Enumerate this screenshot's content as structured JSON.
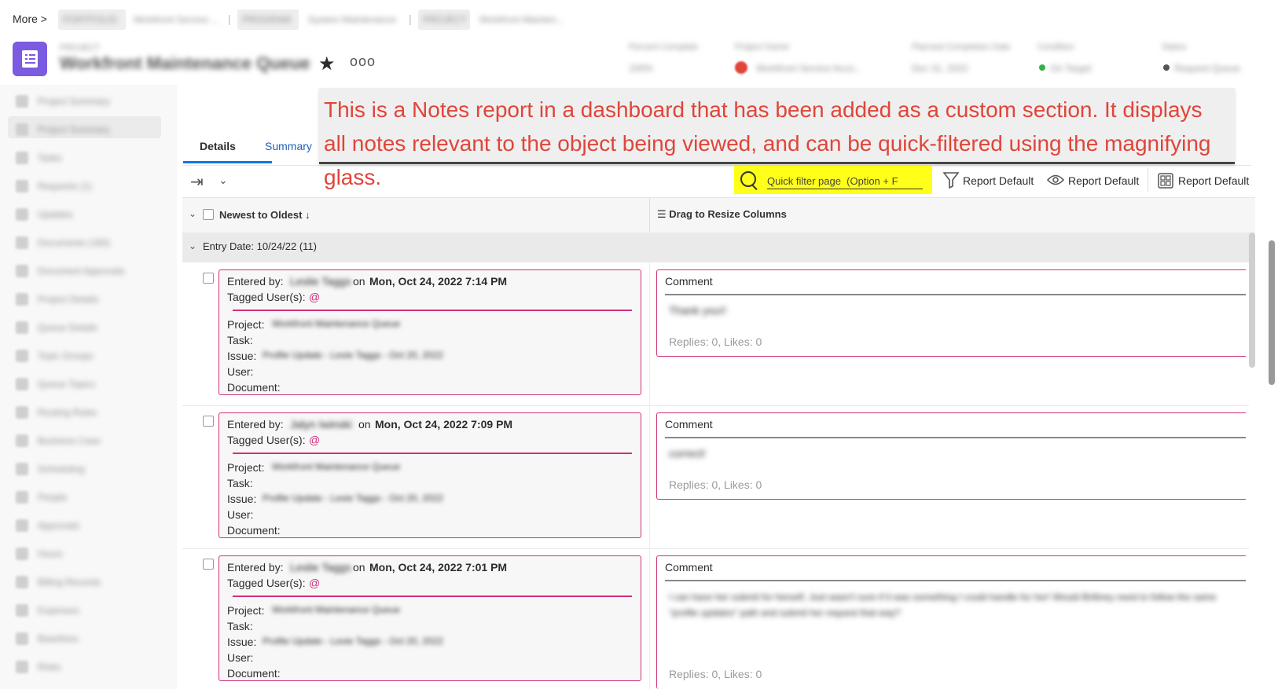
{
  "header": {
    "more_label": "More >",
    "breadcrumbs": [
      "PORTFOLIO",
      "Workfront Service ...",
      "PROGRAM",
      "System Maintenance",
      "PROJECT",
      "Workfront Mainten..."
    ],
    "project_type": "PROJECT",
    "project_title": "Workfront Maintenance Queue",
    "meta": [
      {
        "label": "Percent Complete",
        "value": "100%"
      },
      {
        "label": "Project Owner",
        "value": "Workfront Service Acco..."
      },
      {
        "label": "Planned Completion Date",
        "value": "Dec 31, 2022"
      },
      {
        "label": "Condition",
        "value": "On Target"
      },
      {
        "label": "Status",
        "value": "Request Queue"
      }
    ],
    "colors": {
      "app_icon": "#7b5be0",
      "owner_dot": "#e0453a",
      "condition_dot": "#2db34a"
    }
  },
  "sidebar": {
    "items": [
      "Project Summary",
      "Project Summary",
      "Tasks",
      "Requests (1)",
      "Updates",
      "Documents (160)",
      "Document Approvals",
      "Project Details",
      "Queue Details",
      "Topic Groups",
      "Queue Topics",
      "Routing Rules",
      "Business Case",
      "Scheduling",
      "People",
      "Approvals",
      "Hours",
      "Billing Records",
      "Expenses",
      "Baselines",
      "Risks"
    ]
  },
  "tabs": {
    "details": "Details",
    "summary": "Summary"
  },
  "annotation": {
    "text": "This is a Notes report in a dashboard that has been added as a custom section. It displays all notes relevant to the object being viewed, and can be quick-filtered using the magnifying glass.",
    "color": "#e0453a"
  },
  "toolbar": {
    "search_placeholder": "Quick filter page  (Option + F",
    "filter_label": "Report Default",
    "view_label": "Report Default",
    "grouping_label": "Report Default",
    "highlight_color": "#ffff1a"
  },
  "table": {
    "sort_label": "Newest to Oldest",
    "drag_label": "Drag to Resize Columns",
    "group_label": "Entry Date: 10/24/22 (11)",
    "field_labels": {
      "entered_by": "Entered by:",
      "on": "on",
      "tagged": "Tagged User(s):",
      "at": "@",
      "project": "Project:",
      "task": "Task:",
      "issue": "Issue:",
      "user": "User:",
      "document": "Document:",
      "comment": "Comment"
    },
    "rows": [
      {
        "author": "Leslie Taggs",
        "datetime": "Mon, Oct 24, 2022 7:14 PM",
        "project": "Workfront Maintenance Queue",
        "issue": "Profile Update - Lexie Taggs - Oct 20, 2022",
        "comment": "Thank you!!",
        "replies": "Replies: 0, Likes: 0"
      },
      {
        "author": "Jalyn Iwinski",
        "datetime": "Mon, Oct 24, 2022 7:09 PM",
        "project": "Workfront Maintenance Queue",
        "issue": "Profile Update - Lexie Taggs - Oct 20, 2022",
        "comment": "correct!",
        "replies": "Replies: 0, Likes: 0"
      },
      {
        "author": "Leslie Taggs",
        "datetime": "Mon, Oct 24, 2022 7:01 PM",
        "project": "Workfront Maintenance Queue",
        "issue": "Profile Update - Lexie Taggs - Oct 20, 2022",
        "comment": "I can have her submit for herself, Just wasn't sure if it was something I could handle for her! Would Brittney need to follow the same \"profile updates\" path and submit her request that way?",
        "replies": "Replies: 0, Likes: 0"
      }
    ],
    "accent_color": "#d0307a"
  }
}
